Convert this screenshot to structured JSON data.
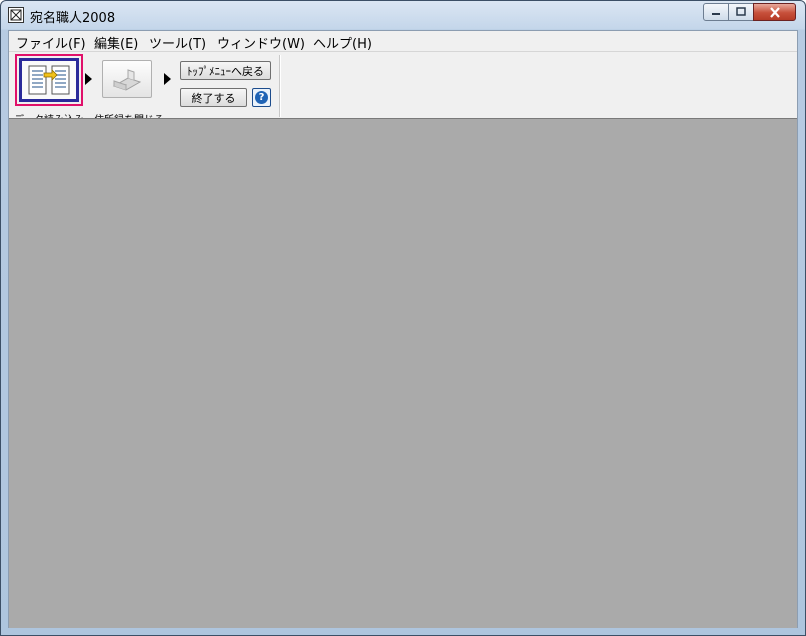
{
  "window": {
    "title": "宛名職人2008",
    "icon": "address-app-icon",
    "controls": [
      "minimize-icon",
      "maximize-icon",
      "close-icon"
    ]
  },
  "menubar": {
    "items": [
      {
        "label": "ファイル(F)"
      },
      {
        "label": "編集(E)"
      },
      {
        "label": "ツール(T)"
      },
      {
        "label": "ウィンドウ(W)"
      },
      {
        "label": "ヘルプ(H)"
      }
    ]
  },
  "toolbar": {
    "read_data": {
      "label": "データ読み込み",
      "icon": "address-book-load-icon"
    },
    "close_book": {
      "label": "住所録を閉じる",
      "icon": "close-book-icon"
    },
    "back_to_top": {
      "label": "ﾄｯﾌﾟﾒﾆｭｰへ戻る"
    },
    "exit": {
      "label": "終了する"
    },
    "help": {
      "label": "?",
      "icon": "help-icon"
    }
  },
  "colors": {
    "workspace": "#aaaaaa",
    "selection_outer": "#e0106a",
    "selection_inner": "#2a2a9a"
  }
}
